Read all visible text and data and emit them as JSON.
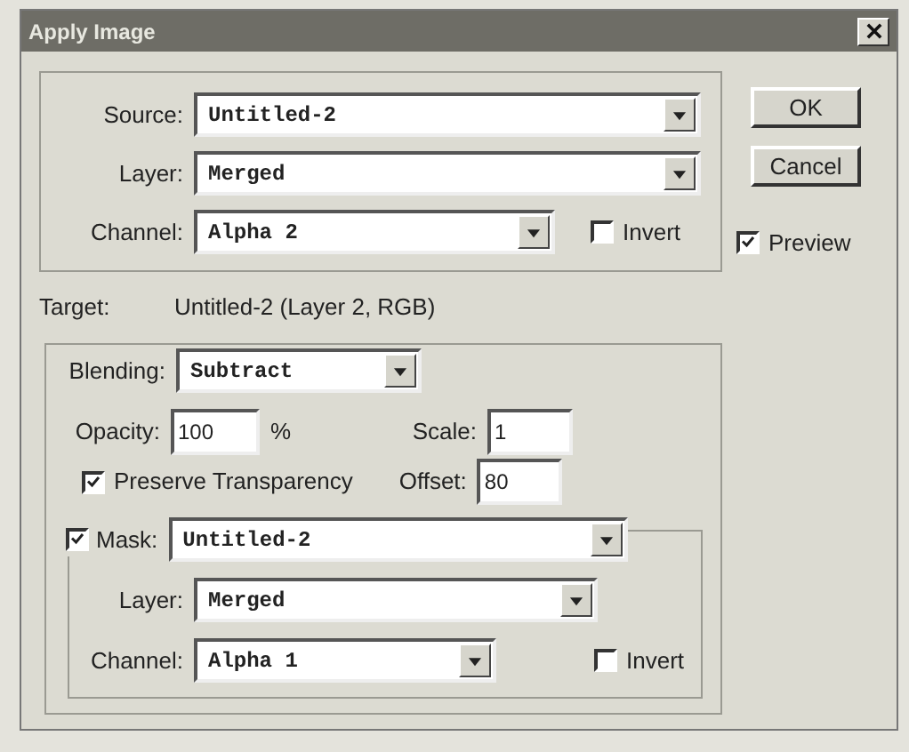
{
  "window": {
    "title": "Apply Image"
  },
  "source": {
    "source": {
      "label": "Source:",
      "value": "Untitled-2"
    },
    "layer": {
      "label": "Layer:",
      "value": "Merged"
    },
    "channel": {
      "label": "Channel:",
      "value": "Alpha 2"
    },
    "invert": {
      "label": "Invert",
      "checked": false
    }
  },
  "buttons": [
    {
      "label": "OK"
    },
    {
      "label": "Cancel"
    }
  ],
  "preview": {
    "label": "Preview",
    "checked": true
  },
  "target": {
    "label": "Target:",
    "value": "Untitled-2 (Layer 2, RGB)"
  },
  "blending": {
    "label": "Blending:",
    "value": "Subtract",
    "opacity": {
      "label": "Opacity:",
      "value": "100",
      "unit": "%"
    },
    "scale": {
      "label": "Scale:",
      "value": "1"
    },
    "preserve_transparency": {
      "label": "Preserve Transparency",
      "checked": true
    },
    "offset": {
      "label": "Offset:",
      "value": "80"
    },
    "mask": {
      "label": "Mask:",
      "checked": true,
      "value": "Untitled-2",
      "layer": {
        "label": "Layer:",
        "value": "Merged"
      },
      "channel": {
        "label": "Channel:",
        "value": "Alpha 1"
      },
      "invert": {
        "label": "Invert",
        "checked": false
      }
    }
  }
}
